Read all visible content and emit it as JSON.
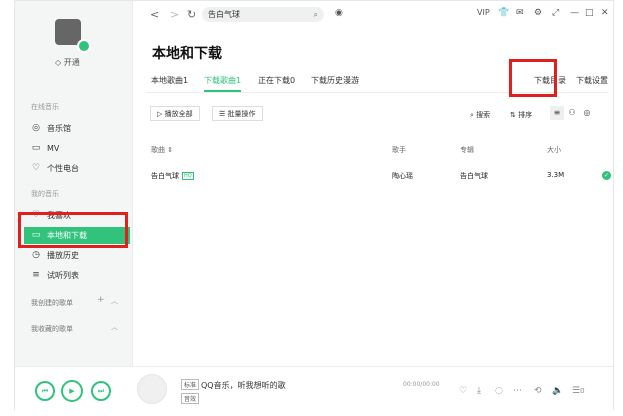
{
  "sidebar": {
    "vip_label": "开通",
    "online_music_label": "在线音乐",
    "online_items": [
      {
        "label": "音乐馆",
        "icon": "music-hall-icon"
      },
      {
        "label": "MV",
        "icon": "mv-icon"
      },
      {
        "label": "个性电台",
        "icon": "radio-icon"
      }
    ],
    "my_music_label": "我的音乐",
    "my_items": [
      {
        "label": "我喜欢",
        "icon": "heart-icon"
      },
      {
        "label": "本地和下载",
        "icon": "monitor-icon"
      },
      {
        "label": "播放历史",
        "icon": "history-icon"
      },
      {
        "label": "试听列表",
        "icon": "list-icon"
      }
    ],
    "created_playlists_label": "我创建的歌单",
    "collected_playlists_label": "我收藏的歌单"
  },
  "topbar": {
    "search_value": "告白气球",
    "vip_text": "VIP"
  },
  "page": {
    "title": "本地和下载",
    "tabs": [
      {
        "label": "本地歌曲1"
      },
      {
        "label": "下载歌曲1"
      },
      {
        "label": "正在下载0"
      },
      {
        "label": "下载历史漫游"
      }
    ],
    "right_links": [
      {
        "label": "下载目录"
      },
      {
        "label": "下载设置"
      }
    ],
    "play_all_label": "播放全部",
    "batch_label": "批量操作",
    "search_label": "搜索",
    "sort_label": "排序"
  },
  "table": {
    "headers": [
      "歌曲",
      "歌手",
      "专辑",
      "大小"
    ],
    "rows": [
      {
        "song": "告白气球",
        "quality": "HQ",
        "artist": "陶心瑶",
        "album": "告白气球",
        "size": "3.3M"
      }
    ]
  },
  "player": {
    "now_playing": "QQ音乐，听我想听的歌",
    "time": "00:00/00:00",
    "tag1": "标准",
    "tag2": "音效",
    "count": "0"
  },
  "colors": {
    "accent": "#31c27c",
    "highlight": "#e0201e"
  }
}
